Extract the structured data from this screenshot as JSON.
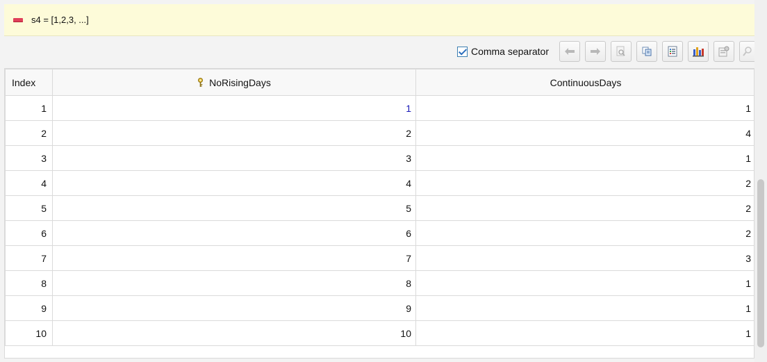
{
  "header": {
    "title": "s4 = [1,2,3, ...]"
  },
  "toolbar": {
    "comma_separator_label": "Comma separator",
    "comma_separator_checked": true,
    "buttons": [
      "back-arrow-icon",
      "forward-arrow-icon",
      "search-icon",
      "copy-icon",
      "list-icon",
      "chart-icon",
      "properties-icon",
      "filter-icon"
    ]
  },
  "table": {
    "columns": [
      "Index",
      "NoRisingDays",
      "ContinuousDays"
    ],
    "rows": [
      {
        "index": "1",
        "no_rising_days": "1",
        "continuous_days": "1"
      },
      {
        "index": "2",
        "no_rising_days": "2",
        "continuous_days": "4"
      },
      {
        "index": "3",
        "no_rising_days": "3",
        "continuous_days": "1"
      },
      {
        "index": "4",
        "no_rising_days": "4",
        "continuous_days": "2"
      },
      {
        "index": "5",
        "no_rising_days": "5",
        "continuous_days": "2"
      },
      {
        "index": "6",
        "no_rising_days": "6",
        "continuous_days": "2"
      },
      {
        "index": "7",
        "no_rising_days": "7",
        "continuous_days": "3"
      },
      {
        "index": "8",
        "no_rising_days": "8",
        "continuous_days": "1"
      },
      {
        "index": "9",
        "no_rising_days": "9",
        "continuous_days": "1"
      },
      {
        "index": "10",
        "no_rising_days": "10",
        "continuous_days": "1"
      }
    ]
  },
  "colors": {
    "header_bg": "#fdfbd9",
    "selected_cell_text": "#1a1ab8",
    "checkbox_accent": "#2a6ebd"
  }
}
